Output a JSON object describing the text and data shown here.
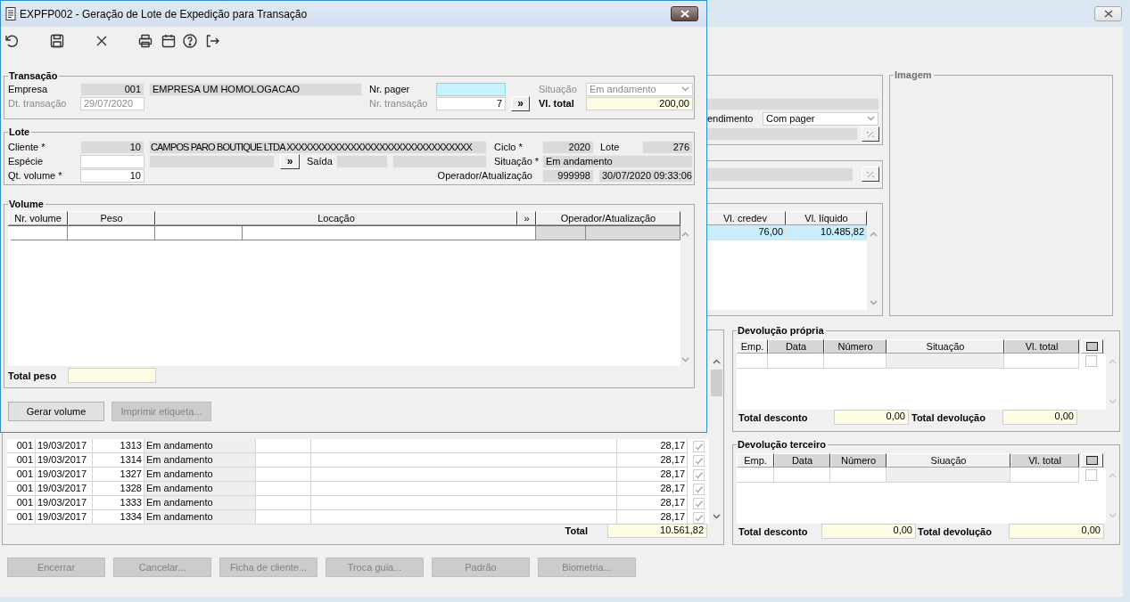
{
  "dialog": {
    "title": "EXPFP002 - Geração de Lote de Expedição para Transação",
    "toolbar": [
      {
        "kind": "undo"
      },
      {
        "kind": "save"
      },
      {
        "kind": "cancel"
      },
      {
        "kind": "print"
      },
      {
        "kind": "calendar"
      },
      {
        "kind": "help"
      },
      {
        "kind": "exit"
      }
    ],
    "transacao": {
      "title": "Transação",
      "empresa": {
        "label": "Empresa",
        "code": "001",
        "name": "EMPRESA UM  HOMOLOGACAO"
      },
      "nr_pager": {
        "label": "Nr. pager",
        "focused": true
      },
      "situacao": {
        "label": "Situação",
        "value": "Em andamento",
        "disabled": true
      },
      "dt_transacao": {
        "label": "Dt. transação",
        "value": "29/07/2020",
        "disabled": true
      },
      "nr_transacao": {
        "label": "Nr. transação",
        "value": "7",
        "disabled": true,
        "button": "»"
      },
      "vl_total": {
        "label": "Vl. total",
        "value": "200,00"
      }
    },
    "lote": {
      "title": "Lote",
      "cliente": {
        "label": "Cliente *",
        "code": "10",
        "name": "CAMPOS PARO BOUTIQUE LTDA XXXXXXXXXXXXXXXXXXXXXXXXXXXXXXXX"
      },
      "ciclo": {
        "label": "Ciclo *",
        "value": "2020"
      },
      "lote": {
        "label": "Lote",
        "value": "276"
      },
      "especie": {
        "label": "Espécie",
        "button": "»"
      },
      "saida": {
        "label": "Saída"
      },
      "situacao": {
        "label": "Situação *",
        "value": "Em andamento"
      },
      "qt_volume": {
        "label": "Qt. volume *",
        "value": "10"
      },
      "operador": {
        "label": "Operador/Atualização",
        "user": "999998",
        "updated": "30/07/2020 09:33:06"
      }
    },
    "volume": {
      "title": "Volume",
      "columns": [
        "Nr. volume",
        "Peso",
        "Locação",
        "»",
        "Operador/Atualização"
      ],
      "total_label": "Total peso"
    },
    "buttons": [
      {
        "label": "Gerar volume",
        "disabled": false
      },
      {
        "label": "Imprimir etiqueta...",
        "disabled": true
      }
    ]
  },
  "main": {
    "attendance": {
      "label": "endimento",
      "value": "Com pager"
    },
    "summary_table": {
      "columns": [
        "Vl. credev",
        "Vl. líquido"
      ],
      "rows": [
        {
          "cells": [
            "76,00",
            "10.485,82"
          ],
          "selected": true
        }
      ]
    },
    "image_panel": {
      "title": "Imagem",
      "disabled": true
    },
    "guides_table": {
      "rows": [
        {
          "cells": [
            "001",
            "19/03/2017",
            "1313",
            "Em andamento",
            "28,17"
          ],
          "checked": true
        },
        {
          "cells": [
            "001",
            "19/03/2017",
            "1314",
            "Em andamento",
            "28,17"
          ],
          "checked": true
        },
        {
          "cells": [
            "001",
            "19/03/2017",
            "1327",
            "Em andamento",
            "28,17"
          ],
          "checked": true
        },
        {
          "cells": [
            "001",
            "19/03/2017",
            "1328",
            "Em andamento",
            "28,17"
          ],
          "checked": true
        },
        {
          "cells": [
            "001",
            "19/03/2017",
            "1333",
            "Em andamento",
            "28,17"
          ],
          "checked": true
        },
        {
          "cells": [
            "001",
            "19/03/2017",
            "1334",
            "Em andamento",
            "28,17"
          ],
          "checked": true
        }
      ],
      "total_label": "Total",
      "total": "10.561,82"
    },
    "devolucao_propria": {
      "title": "Devolução própria",
      "columns": [
        {
          "label": "Emp.",
          "shaded": false
        },
        {
          "label": "Data",
          "shaded": true
        },
        {
          "label": "Número",
          "shaded": true
        },
        {
          "label": "Situação",
          "shaded": false
        },
        {
          "label": "Vl. total",
          "shaded": true
        }
      ],
      "rows": [
        {
          "checked": false
        }
      ],
      "discount_label": "Total desconto",
      "discount": "0,00",
      "returns_label": "Total devolução",
      "returns": "0,00"
    },
    "devolucao_terceiro": {
      "title": "Devolução terceiro",
      "columns": [
        {
          "label": "Emp.",
          "shaded": false
        },
        {
          "label": "Data",
          "shaded": true
        },
        {
          "label": "Número",
          "shaded": true
        },
        {
          "label": "Siuação",
          "shaded": false
        },
        {
          "label": "Vl. total",
          "shaded": true
        }
      ],
      "rows": [
        {
          "checked": false
        }
      ],
      "discount_label": "Total desconto",
      "discount": "0,00",
      "returns_label": "Total devolução",
      "returns": "0,00"
    },
    "buttons": [
      {
        "label": "Encerrar",
        "disabled": true
      },
      {
        "label": "Cancelar...",
        "disabled": true
      },
      {
        "label": "Ficha de cliente...",
        "disabled": true
      },
      {
        "label": "Troca guia...",
        "disabled": true
      },
      {
        "label": "Padrão",
        "disabled": true
      },
      {
        "label": "Biometria...",
        "disabled": true
      }
    ]
  }
}
